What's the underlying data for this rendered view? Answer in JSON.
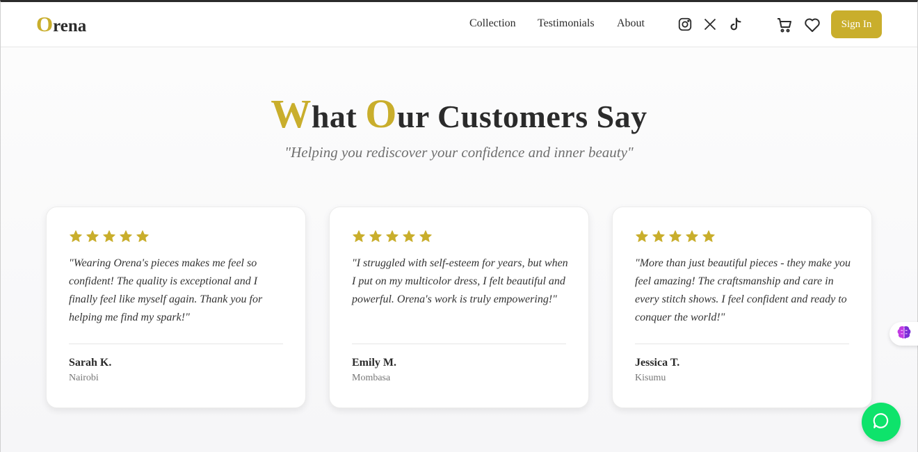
{
  "brand": {
    "first_letter": "O",
    "rest": "rena"
  },
  "nav": {
    "collection": "Collection",
    "testimonials": "Testimonials",
    "about": "About"
  },
  "auth": {
    "signin_label": "Sign In"
  },
  "section": {
    "title_w": "W",
    "title_hat": "hat ",
    "title_o": "O",
    "title_rest": "ur Customers Say",
    "subtitle": "\"Helping you rediscover your confidence and inner beauty\""
  },
  "colors": {
    "accent": "#c9ae2c",
    "chat_green": "#0ee36b"
  },
  "testimonials": [
    {
      "rating": 5,
      "quote": "\"Wearing Orena's pieces makes me feel so confident! The quality is exceptional and I finally feel like myself again. Thank you for helping me find my spark!\"",
      "name": "Sarah K.",
      "location": "Nairobi"
    },
    {
      "rating": 5,
      "quote": "\"I struggled with self-esteem for years, but when I put on my multicolor dress, I felt beautiful and powerful. Orena's work is truly empowering!\"",
      "name": "Emily M.",
      "location": "Mombasa"
    },
    {
      "rating": 5,
      "quote": "\"More than just beautiful pieces - they make you feel amazing! The craftsmanship and care in every stitch shows. I feel confident and ready to conquer the world!\"",
      "name": "Jessica T.",
      "location": "Kisumu"
    }
  ],
  "icons": [
    "instagram-icon",
    "x-icon",
    "tiktok-icon",
    "cart-icon",
    "heart-icon",
    "brain-icon",
    "chat-icon",
    "star-icon"
  ]
}
